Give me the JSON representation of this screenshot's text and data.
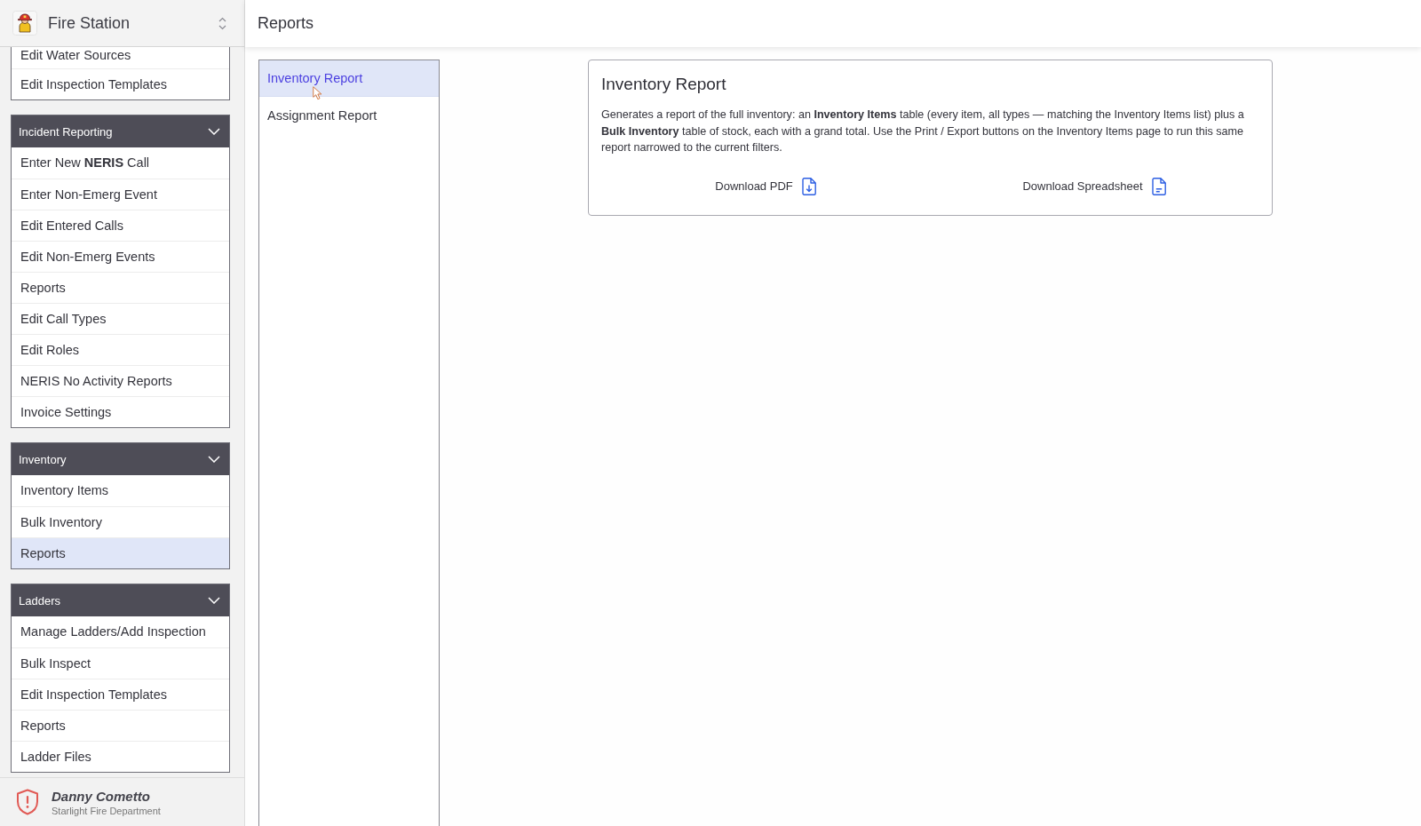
{
  "sidebar": {
    "app_title": "Fire Station",
    "sections": [
      {
        "items": [
          {
            "label": "Edit Water Sources",
            "selected": false
          },
          {
            "label": "Edit Inspection Templates",
            "selected": false
          }
        ]
      },
      {
        "title": "Incident Reporting",
        "expanded": true,
        "items": [
          {
            "label": "Enter New **NERIS** Call",
            "selected": false
          },
          {
            "label": "Enter Non-Emerg Event",
            "selected": false
          },
          {
            "label": "Edit Entered Calls",
            "selected": false
          },
          {
            "label": "Edit Non-Emerg Events",
            "selected": false
          },
          {
            "label": "Reports",
            "selected": false
          },
          {
            "label": "Edit Call Types",
            "selected": false
          },
          {
            "label": "Edit Roles",
            "selected": false
          },
          {
            "label": "NERIS No Activity Reports",
            "selected": false
          },
          {
            "label": "Invoice Settings",
            "selected": false
          }
        ]
      },
      {
        "title": "Inventory",
        "expanded": true,
        "items": [
          {
            "label": "Inventory Items",
            "selected": false
          },
          {
            "label": "Bulk Inventory",
            "selected": false
          },
          {
            "label": "Reports",
            "selected": true
          }
        ]
      },
      {
        "title": "Ladders",
        "expanded": true,
        "items": [
          {
            "label": "Manage Ladders/Add Inspection",
            "selected": false
          },
          {
            "label": "Bulk Inspect",
            "selected": false
          },
          {
            "label": "Edit Inspection Templates",
            "selected": false
          },
          {
            "label": "Reports",
            "selected": false
          },
          {
            "label": "Ladder Files",
            "selected": false
          }
        ]
      }
    ],
    "user": {
      "name": "Danny Cometto",
      "organization": "Starlight Fire Department"
    }
  },
  "page": {
    "title": "Reports"
  },
  "report_list": [
    {
      "label": "Inventory Report",
      "selected": true
    },
    {
      "label": "Assignment Report",
      "selected": false
    }
  ],
  "report_card": {
    "title": "Inventory Report",
    "description": "Generates a report of the full inventory: an **Inventory Items** table (every item, all types — matching the Inventory Items list) plus a **Bulk Inventory** table of stock, each with a grand total. Use the Print / Export buttons on the Inventory Items page to run this same report narrowed to the current filters.",
    "actions": [
      {
        "label": "Download PDF",
        "kind": "pdf"
      },
      {
        "label": "Download Spreadsheet",
        "kind": "spreadsheet"
      }
    ]
  }
}
